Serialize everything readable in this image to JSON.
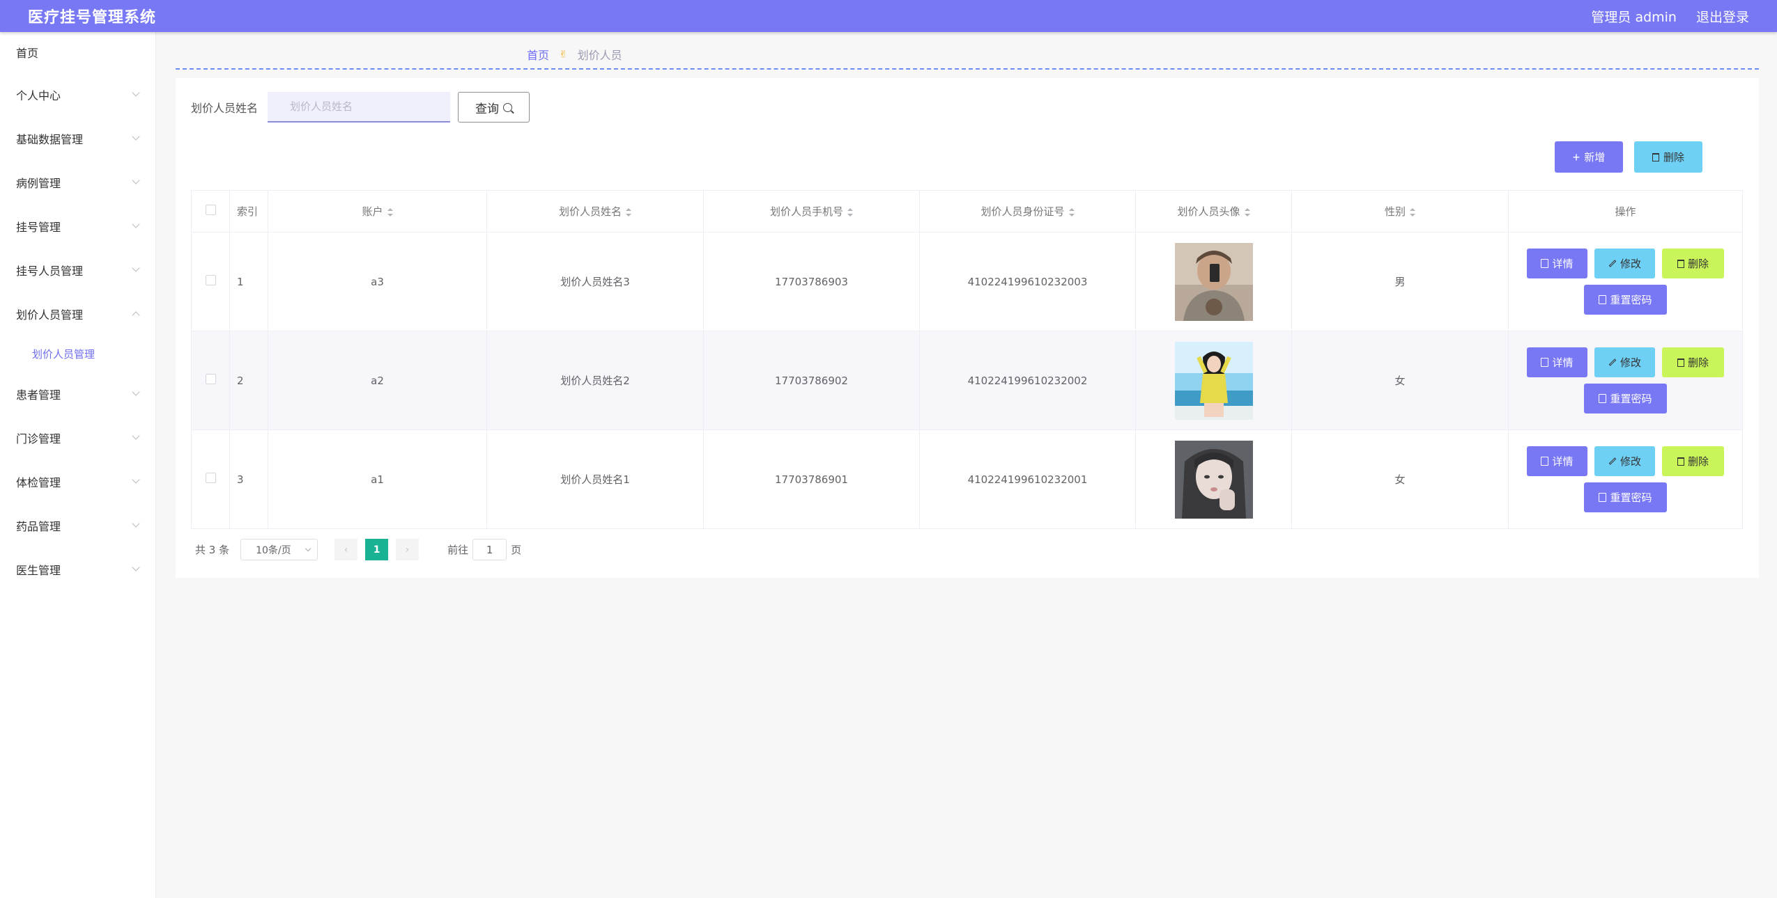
{
  "header": {
    "title": "医疗挂号管理系统",
    "user": "管理员 admin",
    "logout": "退出登录"
  },
  "sidebar": {
    "items": [
      {
        "label": "首页"
      },
      {
        "label": "个人中心"
      },
      {
        "label": "基础数据管理"
      },
      {
        "label": "病例管理"
      },
      {
        "label": "挂号管理"
      },
      {
        "label": "挂号人员管理"
      },
      {
        "label": "划价人员管理"
      },
      {
        "label": "患者管理"
      },
      {
        "label": "门诊管理"
      },
      {
        "label": "体检管理"
      },
      {
        "label": "药品管理"
      },
      {
        "label": "医生管理"
      }
    ],
    "sub_item": "划价人员管理"
  },
  "breadcrumb": {
    "home": "首页",
    "current": "划价人员"
  },
  "search": {
    "label": "划价人员姓名",
    "placeholder": "划价人员姓名",
    "button": "查询"
  },
  "actions": {
    "add": "新增",
    "delete": "删除"
  },
  "table": {
    "headers": {
      "index": "索引",
      "account": "账户",
      "name": "划价人员姓名",
      "phone": "划价人员手机号",
      "idcard": "划价人员身份证号",
      "avatar": "划价人员头像",
      "gender": "性别",
      "ops": "操作"
    },
    "rows": [
      {
        "index": "1",
        "account": "a3",
        "name": "划价人员姓名3",
        "phone": "17703786903",
        "idcard": "410224199610232003",
        "gender": "男"
      },
      {
        "index": "2",
        "account": "a2",
        "name": "划价人员姓名2",
        "phone": "17703786902",
        "idcard": "410224199610232002",
        "gender": "女"
      },
      {
        "index": "3",
        "account": "a1",
        "name": "划价人员姓名1",
        "phone": "17703786901",
        "idcard": "410224199610232001",
        "gender": "女"
      }
    ],
    "row_ops": {
      "detail": "详情",
      "edit": "修改",
      "delete": "删除",
      "reset": "重置密码"
    }
  },
  "pagination": {
    "total": "共 3 条",
    "page_size": "10条/页",
    "current": "1",
    "goto_prefix": "前往",
    "goto_value": "1",
    "goto_suffix": "页"
  },
  "colors": {
    "primary": "#7877f4",
    "info": "#6fd0f5",
    "lime": "#c9f55a",
    "active_page": "#19b394"
  }
}
